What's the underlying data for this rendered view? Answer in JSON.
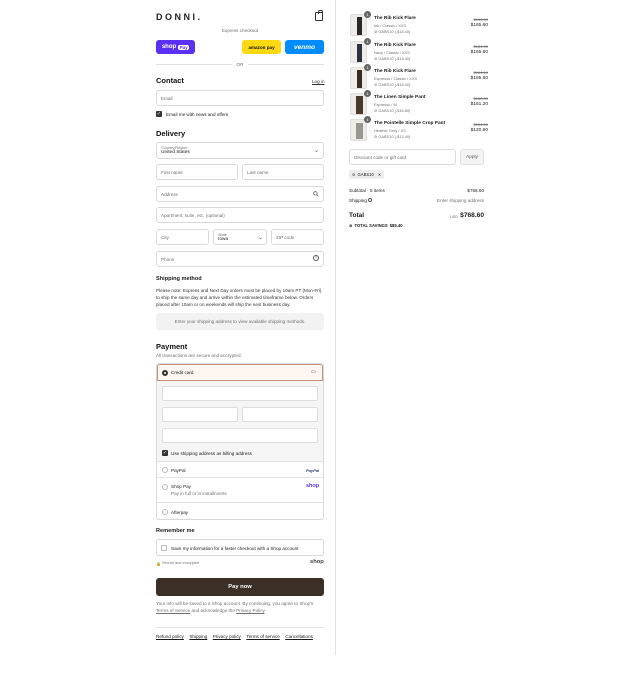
{
  "brand": "DONNI.",
  "express": {
    "heading": "Express checkout",
    "shop_label": "shop",
    "shop_pay_tag": "Pay",
    "amazon_label": "amazon pay",
    "venmo_label": "venmo",
    "or_label": "OR"
  },
  "contact": {
    "title": "Contact",
    "login_link": "Log in",
    "email_placeholder": "Email",
    "newsletter_label": "Email me with news and offers"
  },
  "delivery": {
    "title": "Delivery",
    "country_label": "Country/Region",
    "country_value": "United States",
    "first_name": "First name",
    "last_name": "Last name",
    "address": "Address",
    "apartment": "Apartment, suite, etc. (optional)",
    "city": "City",
    "state_label": "State",
    "state_value": "Iowa",
    "zip": "ZIP code",
    "phone": "Phone"
  },
  "shipping": {
    "title": "Shipping method",
    "note": "Please note: Express and Next Day orders must be placed by 10am PT (Mon-Fri) to ship the same day and arrive within the estimated timeframe below. Orders placed after 10am or on weekends will ship the next business day.",
    "placeholder_box": "Enter your shipping address to view available shipping methods."
  },
  "payment": {
    "title": "Payment",
    "subtitle": "All transactions are secure and encrypted.",
    "credit_card": "Credit card",
    "billing_same": "Use shipping address as billing address",
    "paypal": "PayPal",
    "paypal_logo": "PayPal",
    "shop_pay": "Shop Pay",
    "shop_pay_sub": "Pay in full or in installments",
    "shop_pay_logo": "shop",
    "afterpay": "Afterpay"
  },
  "remember": {
    "title": "Remember me",
    "save_label": "Save my information for a faster checkout with a Shop account",
    "secure_label": "Secure and encrypted",
    "shop_logo": "shop"
  },
  "pay_now": "Pay now",
  "legal": {
    "prefix": "Your info will be saved to a Shop account. By continuing, you agree to Shop's",
    "tos": "Terms of Service",
    "middle": "and acknowledge the",
    "privacy": "Privacy Policy",
    "suffix": "."
  },
  "footer_links": [
    "Refund policy",
    "Shipping",
    "Privacy policy",
    "Terms of service",
    "Cancellations"
  ],
  "cart": {
    "items": [
      {
        "qty": "1",
        "name": "The Rib Kick Flare",
        "variant": "Ink / Classic / XXS",
        "discount": "GABS10 (-$18.40)",
        "original": "$184.00",
        "price": "$165.60"
      },
      {
        "qty": "1",
        "name": "The Rib Kick Flare",
        "variant": "Navy / Classic / XXS",
        "discount": "GABS10 (-$18.40)",
        "original": "$184.00",
        "price": "$165.60"
      },
      {
        "qty": "1",
        "name": "The Rib Kick Flare",
        "variant": "Espresso / Classic / XXS",
        "discount": "GABS10 (-$18.40)",
        "original": "$184.00",
        "price": "$165.60"
      },
      {
        "qty": "1",
        "name": "The Linen Simple Pant",
        "variant": "Espresso / M",
        "discount": "GABS10 (-$16.80)",
        "original": "$168.00",
        "price": "$151.20"
      },
      {
        "qty": "1",
        "name": "The Pointelle Simple Crop Pant",
        "variant": "Heather Grey / XS",
        "discount": "GABS10 (-$13.40)",
        "original": "$134.00",
        "price": "$120.60"
      }
    ],
    "discount_placeholder": "Discount code or gift card",
    "apply": "Apply",
    "applied_code": "GABS10",
    "subtotal_label": "Subtotal · 5 items",
    "subtotal_value": "$768.60",
    "shipping_label": "Shipping",
    "shipping_value": "Enter shipping address",
    "total_label": "Total",
    "currency": "USD",
    "total_value": "$768.60",
    "savings_label": "TOTAL SAVINGS",
    "savings_value": "$85.40"
  },
  "colors": {
    "shop_purple": "#5a31f4",
    "amazon_yellow": "#ffd814",
    "venmo_blue": "#008cff",
    "button_dark": "#3b2f26",
    "selected_bg": "#fdf6f1",
    "selected_border": "#c69178"
  }
}
